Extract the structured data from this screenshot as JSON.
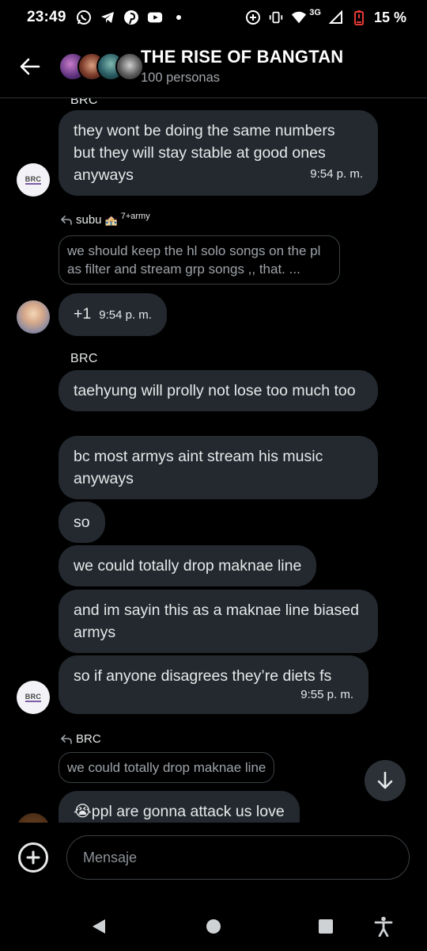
{
  "status_bar": {
    "time": "23:49",
    "network": "3G",
    "battery": "15 %",
    "left_icons": [
      "whatsapp-icon",
      "telegram-icon",
      "pinterest-icon",
      "youtube-icon",
      "dot-icon"
    ],
    "right_icons": [
      "data-saver-icon",
      "vibrate-icon",
      "wifi-icon",
      "signal-icon",
      "battery-icon"
    ]
  },
  "header": {
    "title": "THE RISE OF BANGTAN",
    "subtitle": "100 personas"
  },
  "messages": {
    "top_sender": "BRC",
    "m1_text": "they wont be doing the same numbers but they will stay stable at good ones anyways",
    "m1_time": "9:54 p. m.",
    "r1_name": "subu",
    "r1_emoji": "🏤",
    "r1_sup": "7+army",
    "r1_quote": "we should keep the hl solo songs on the pl as filter and stream grp songs ,, that. ...",
    "m2_text": "+1",
    "m2_time": "9:54 p. m.",
    "sender2": "BRC",
    "m3_text": "taehyung will prolly not lose too much too",
    "m4_text": "bc most armys aint stream his music anyways",
    "m5_text": "so",
    "m6_text": "we could totally drop maknae line",
    "m7_text": "and im sayin this as a maknae line biased armys",
    "m8_text": "so if anyone disagrees they’re diets fs",
    "m8_time": "9:55 p. m.",
    "r2_name": "BRC",
    "r2_quote": "we could totally drop maknae line",
    "m9_emoji": "😭",
    "m9_text": "ppl are gonna attack us love",
    "avatar_brc_label": "BRC"
  },
  "composer": {
    "placeholder": "Mensaje"
  },
  "colors": {
    "background": "#000000",
    "bubble": "#23292f",
    "border": "#3b4146",
    "text": "#e7e9ea",
    "muted": "#9ea3a8"
  }
}
